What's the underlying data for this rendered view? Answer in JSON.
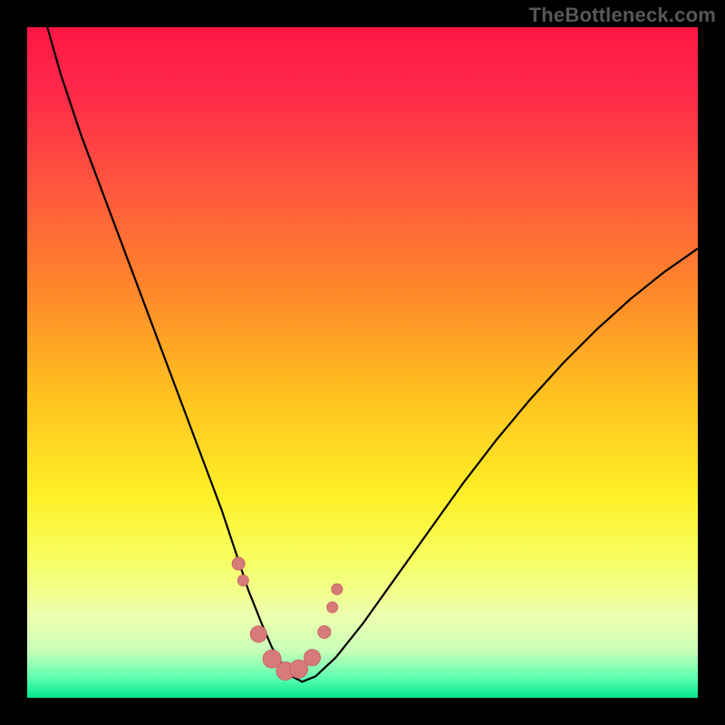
{
  "watermark": "TheBottleneck.com",
  "colors": {
    "black": "#000000",
    "curve": "#000000",
    "marker_fill": "#d77a7a",
    "marker_stroke": "#c96868",
    "gradient_stops": [
      {
        "offset": 0.0,
        "color": "#ff1744"
      },
      {
        "offset": 0.1,
        "color": "#ff2a4a"
      },
      {
        "offset": 0.25,
        "color": "#ff5a3c"
      },
      {
        "offset": 0.4,
        "color": "#ff8a2a"
      },
      {
        "offset": 0.55,
        "color": "#ffc21f"
      },
      {
        "offset": 0.7,
        "color": "#fff028"
      },
      {
        "offset": 0.8,
        "color": "#f7ff66"
      },
      {
        "offset": 0.88,
        "color": "#ecffb0"
      },
      {
        "offset": 0.93,
        "color": "#c8ffb8"
      },
      {
        "offset": 0.97,
        "color": "#5dffb0"
      },
      {
        "offset": 1.0,
        "color": "#00e68a"
      }
    ]
  },
  "chart_data": {
    "type": "line",
    "title": "",
    "xlabel": "",
    "ylabel": "",
    "xlim": [
      0,
      100
    ],
    "ylim": [
      0,
      100
    ],
    "series": [
      {
        "name": "bottleneck-curve",
        "x": [
          3,
          5,
          8,
          11,
          14,
          17,
          20,
          23,
          26,
          29,
          31,
          33,
          35,
          36.5,
          38,
          39.5,
          41,
          43,
          46,
          50,
          55,
          60,
          65,
          70,
          75,
          80,
          85,
          90,
          95,
          100
        ],
        "y": [
          100,
          93,
          84,
          76,
          68,
          60,
          52,
          44,
          36,
          28,
          22,
          16,
          11,
          7.5,
          5,
          3.2,
          2.4,
          3.2,
          6,
          11,
          18,
          25,
          32,
          38.5,
          44.5,
          50,
          55,
          59.5,
          63.5,
          67
        ]
      }
    ],
    "markers": {
      "name": "highlight-points",
      "x": [
        31.5,
        32.2,
        34.5,
        36.5,
        38.5,
        40.5,
        42.5,
        44.3,
        45.5,
        46.2
      ],
      "y": [
        20,
        17.5,
        9.5,
        5.8,
        4.0,
        4.3,
        6.0,
        9.8,
        13.5,
        16.2
      ],
      "r": [
        7,
        6,
        9,
        10,
        10,
        10,
        9,
        7,
        6,
        6
      ]
    }
  }
}
